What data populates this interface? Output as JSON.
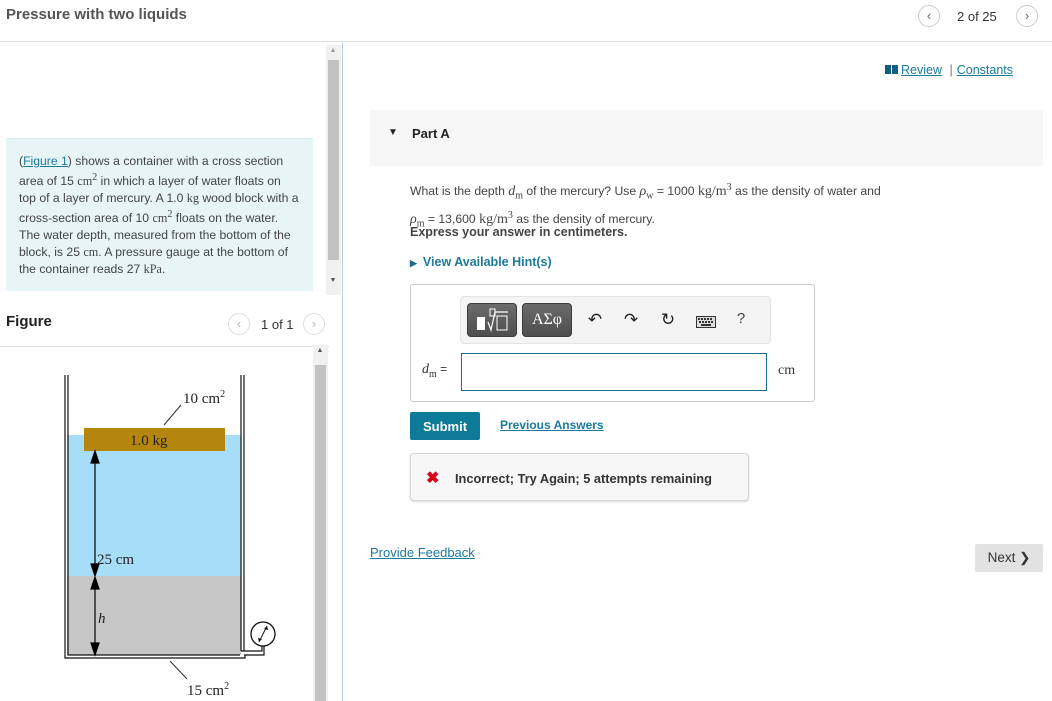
{
  "header": {
    "title": "Pressure with two liquids",
    "position": "2 of 25",
    "prev_icon": "‹",
    "next_icon": "›"
  },
  "problem": {
    "figure_link": "Figure 1",
    "text_1": ") shows a container with a cross section area of 15 ",
    "unit_cm": "cm",
    "sup_2": "2",
    "text_2": " in which a layer of water floats on top of a layer of mercury. A 1.0 ",
    "unit_kg": "kg",
    "text_3": " wood block with a cross-section area of 10 ",
    "text_4": " floats on the water. The water depth, measured from the bottom of the block, is 25 ",
    "text_5": ". A pressure gauge at the bottom of the container reads 27 ",
    "unit_kpa": "kPa",
    "text_6": "."
  },
  "figure": {
    "title": "Figure",
    "position": "1 of 1",
    "block_area": "10 cm",
    "block_mass": "1.0 kg",
    "water_depth": "25 cm",
    "mercury_depth": "h",
    "container_area": "15 cm",
    "sup": "2",
    "colors": {
      "water": "#a6ddf9",
      "mercury": "#c6c6c6",
      "block": "#b5860d"
    }
  },
  "links": {
    "review": "Review",
    "separator": "|",
    "constants": "Constants"
  },
  "part": {
    "title": "Part A",
    "q_1": "What is the depth ",
    "q_dm": "d",
    "q_m": "m",
    "q_2": " of the mercury? Use ",
    "q_rho": "ρ",
    "q_w": "w",
    "q_3": " = 1000 ",
    "q_unit": "kg/m",
    "q_sup3": "3",
    "q_4": " as the density of water and ",
    "q_5": " = 13,600 ",
    "q_6": " as the density of mercury.",
    "express": "Express your answer in centimeters.",
    "hint": "View Available Hint(s)"
  },
  "answer": {
    "toolbar": {
      "greek": "ΑΣφ",
      "undo": "↶",
      "redo": "↷",
      "reset": "↻",
      "help": "?"
    },
    "label_d": "d",
    "label_m": "m",
    "label_eq": " =",
    "value": "",
    "unit": "cm"
  },
  "actions": {
    "submit": "Submit",
    "previous_answers": "Previous Answers",
    "feedback_icon": "✖",
    "feedback_text": "Incorrect; Try Again; 5 attempts remaining",
    "provide_feedback": "Provide Feedback",
    "next": "Next ❯"
  },
  "colors": {
    "accent": "#0d7a99",
    "link": "#1a7a9e",
    "error": "#d9001b"
  }
}
